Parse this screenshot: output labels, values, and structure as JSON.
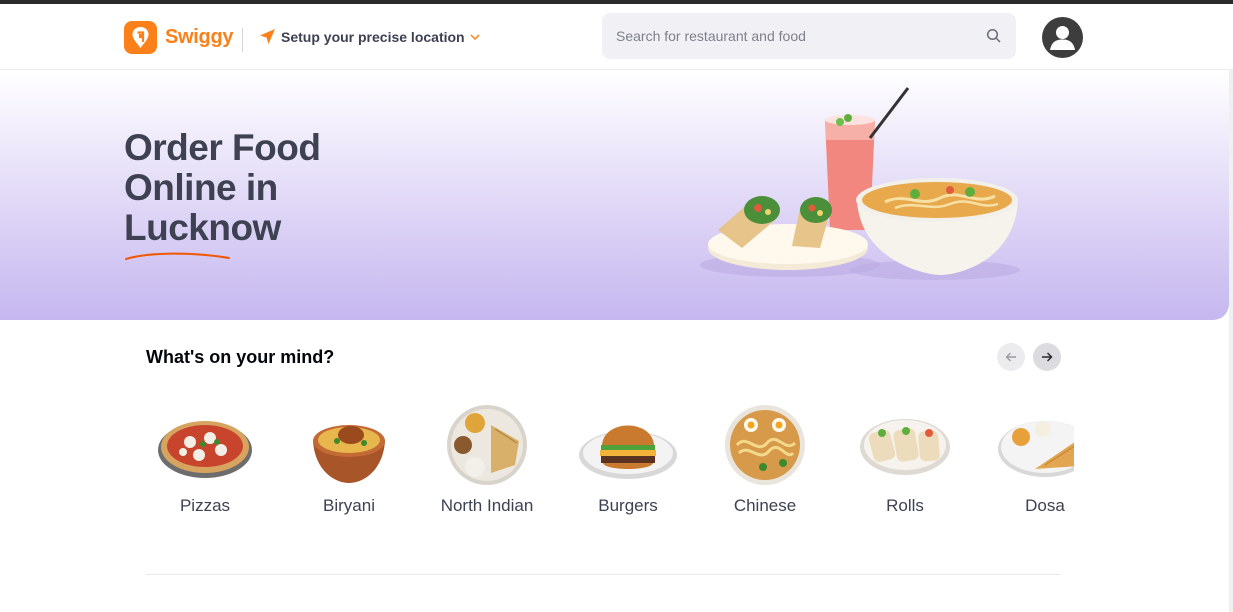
{
  "brand": {
    "name": "Swiggy",
    "accent": "#fc8019"
  },
  "header": {
    "location_label": "Setup your precise location",
    "search_placeholder": "Search for restaurant and food"
  },
  "hero": {
    "title_lines": [
      "Order Food",
      "Online in",
      "Lucknow"
    ],
    "underline_color": "#f15700",
    "bg_colors": [
      "#ffffff",
      "#c5b7ef"
    ]
  },
  "mind_section": {
    "title": "What's on your mind?",
    "prev_icon": "arrow-left-icon",
    "next_icon": "arrow-right-icon",
    "items": [
      {
        "label": "Pizzas",
        "icon": "pizza-image"
      },
      {
        "label": "Biryani",
        "icon": "biryani-image"
      },
      {
        "label": "North Indian",
        "icon": "north-indian-thali-image"
      },
      {
        "label": "Burgers",
        "icon": "burger-image"
      },
      {
        "label": "Chinese",
        "icon": "noodles-image"
      },
      {
        "label": "Rolls",
        "icon": "rolls-image"
      },
      {
        "label": "Dosa",
        "icon": "dosa-image"
      }
    ]
  }
}
